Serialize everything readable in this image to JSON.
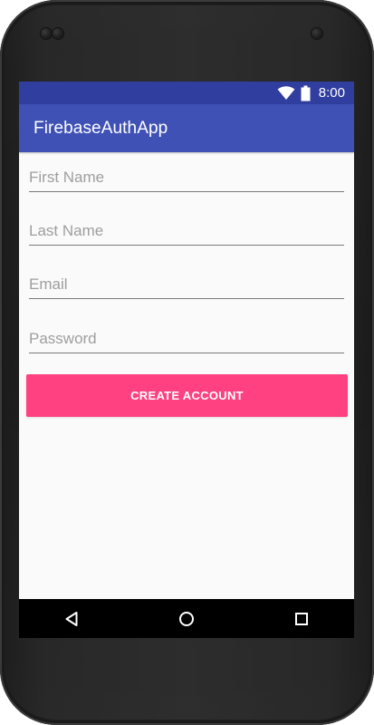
{
  "device": {
    "frame_color": "#242424"
  },
  "status_bar": {
    "time": "8:00",
    "background_color": "#303f9f",
    "icons": [
      "wifi-icon",
      "battery-icon"
    ]
  },
  "app_bar": {
    "title": "FirebaseAuthApp",
    "background_color": "#3f51b5"
  },
  "form": {
    "first_name": {
      "placeholder": "First Name",
      "value": ""
    },
    "last_name": {
      "placeholder": "Last Name",
      "value": ""
    },
    "email": {
      "placeholder": "Email",
      "value": ""
    },
    "password": {
      "placeholder": "Password",
      "value": ""
    },
    "create_account_label": "CREATE ACCOUNT",
    "button_color": "#ff4081"
  },
  "navigation_bar": {
    "icons": [
      "back-icon",
      "home-icon",
      "recent-apps-icon"
    ]
  }
}
